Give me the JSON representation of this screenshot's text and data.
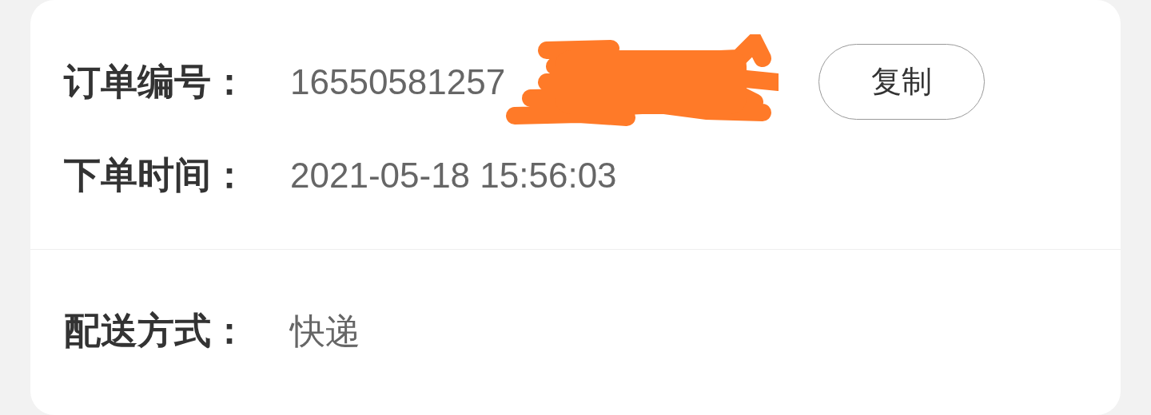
{
  "order_info": {
    "rows": [
      {
        "label": "订单编号：",
        "value": "16550581257",
        "redacted": true,
        "action": "复制"
      },
      {
        "label": "下单时间：",
        "value": "2021-05-18 15:56:03"
      }
    ]
  },
  "delivery": {
    "rows": [
      {
        "label": "配送方式：",
        "value": "快递"
      }
    ]
  }
}
